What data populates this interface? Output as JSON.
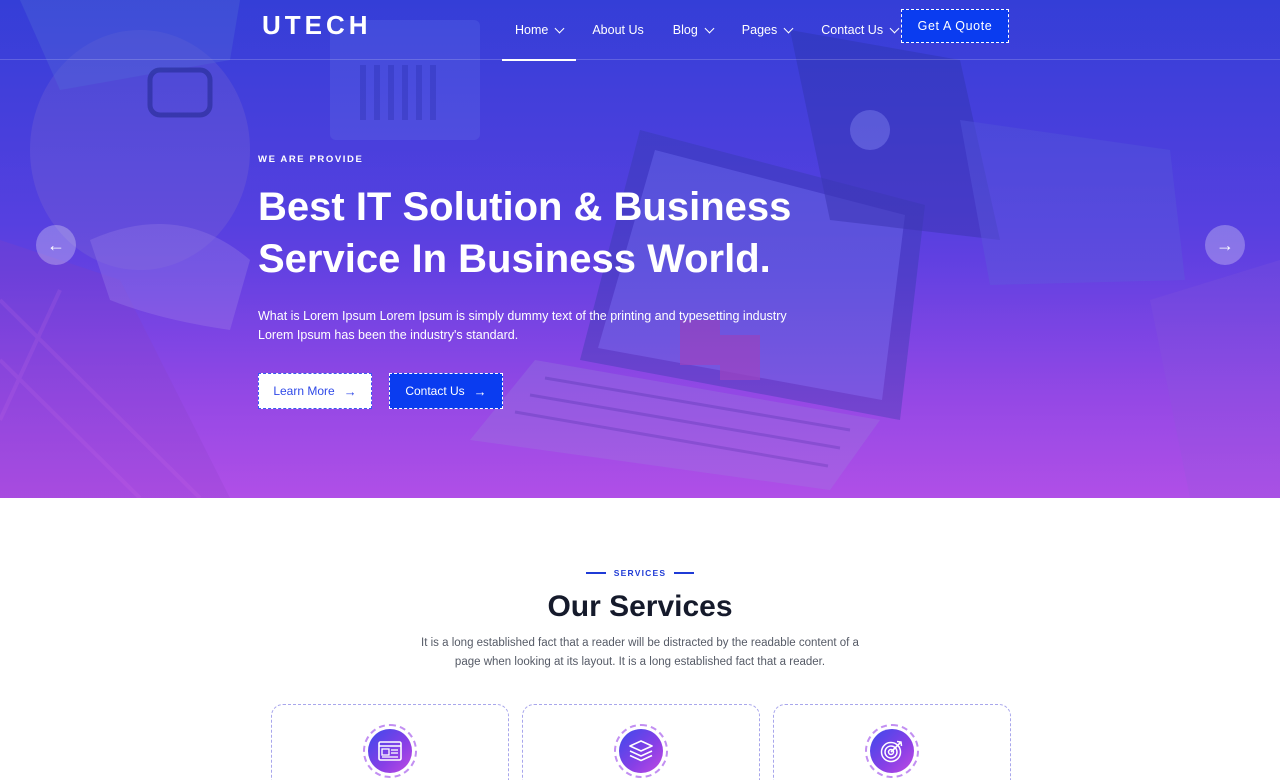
{
  "header": {
    "logo": "UTECH",
    "nav": [
      {
        "label": "Home",
        "dropdown": true,
        "active": true
      },
      {
        "label": "About Us",
        "dropdown": false
      },
      {
        "label": "Blog",
        "dropdown": true
      },
      {
        "label": "Pages",
        "dropdown": true
      },
      {
        "label": "Contact Us",
        "dropdown": true
      }
    ],
    "quote_button": "Get A Quote"
  },
  "hero": {
    "eyebrow": "WE ARE PROVIDE",
    "title_line1": "Best IT Solution & Business",
    "title_line2": "Service In Business World.",
    "description": "What is Lorem Ipsum Lorem Ipsum is simply dummy text of the printing and typesetting industry Lorem Ipsum has been the industry's standard.",
    "learn_more": "Learn More",
    "contact_us": "Contact Us",
    "prev_icon": "arrow-left-icon",
    "next_icon": "arrow-right-icon"
  },
  "services": {
    "tag": "SERVICES",
    "title": "Our Services",
    "description": "It is a long established fact that a reader will be distracted by the readable content of a page when looking at its layout. It is a long established fact that a reader.",
    "cards": [
      {
        "icon": "browser-window-icon"
      },
      {
        "icon": "layers-icon"
      },
      {
        "icon": "target-icon"
      }
    ]
  },
  "colors": {
    "primary": "#0a3cf0",
    "gradient_start": "#3d3fd8",
    "gradient_end": "#b04ee6",
    "heading": "#151a2b"
  }
}
